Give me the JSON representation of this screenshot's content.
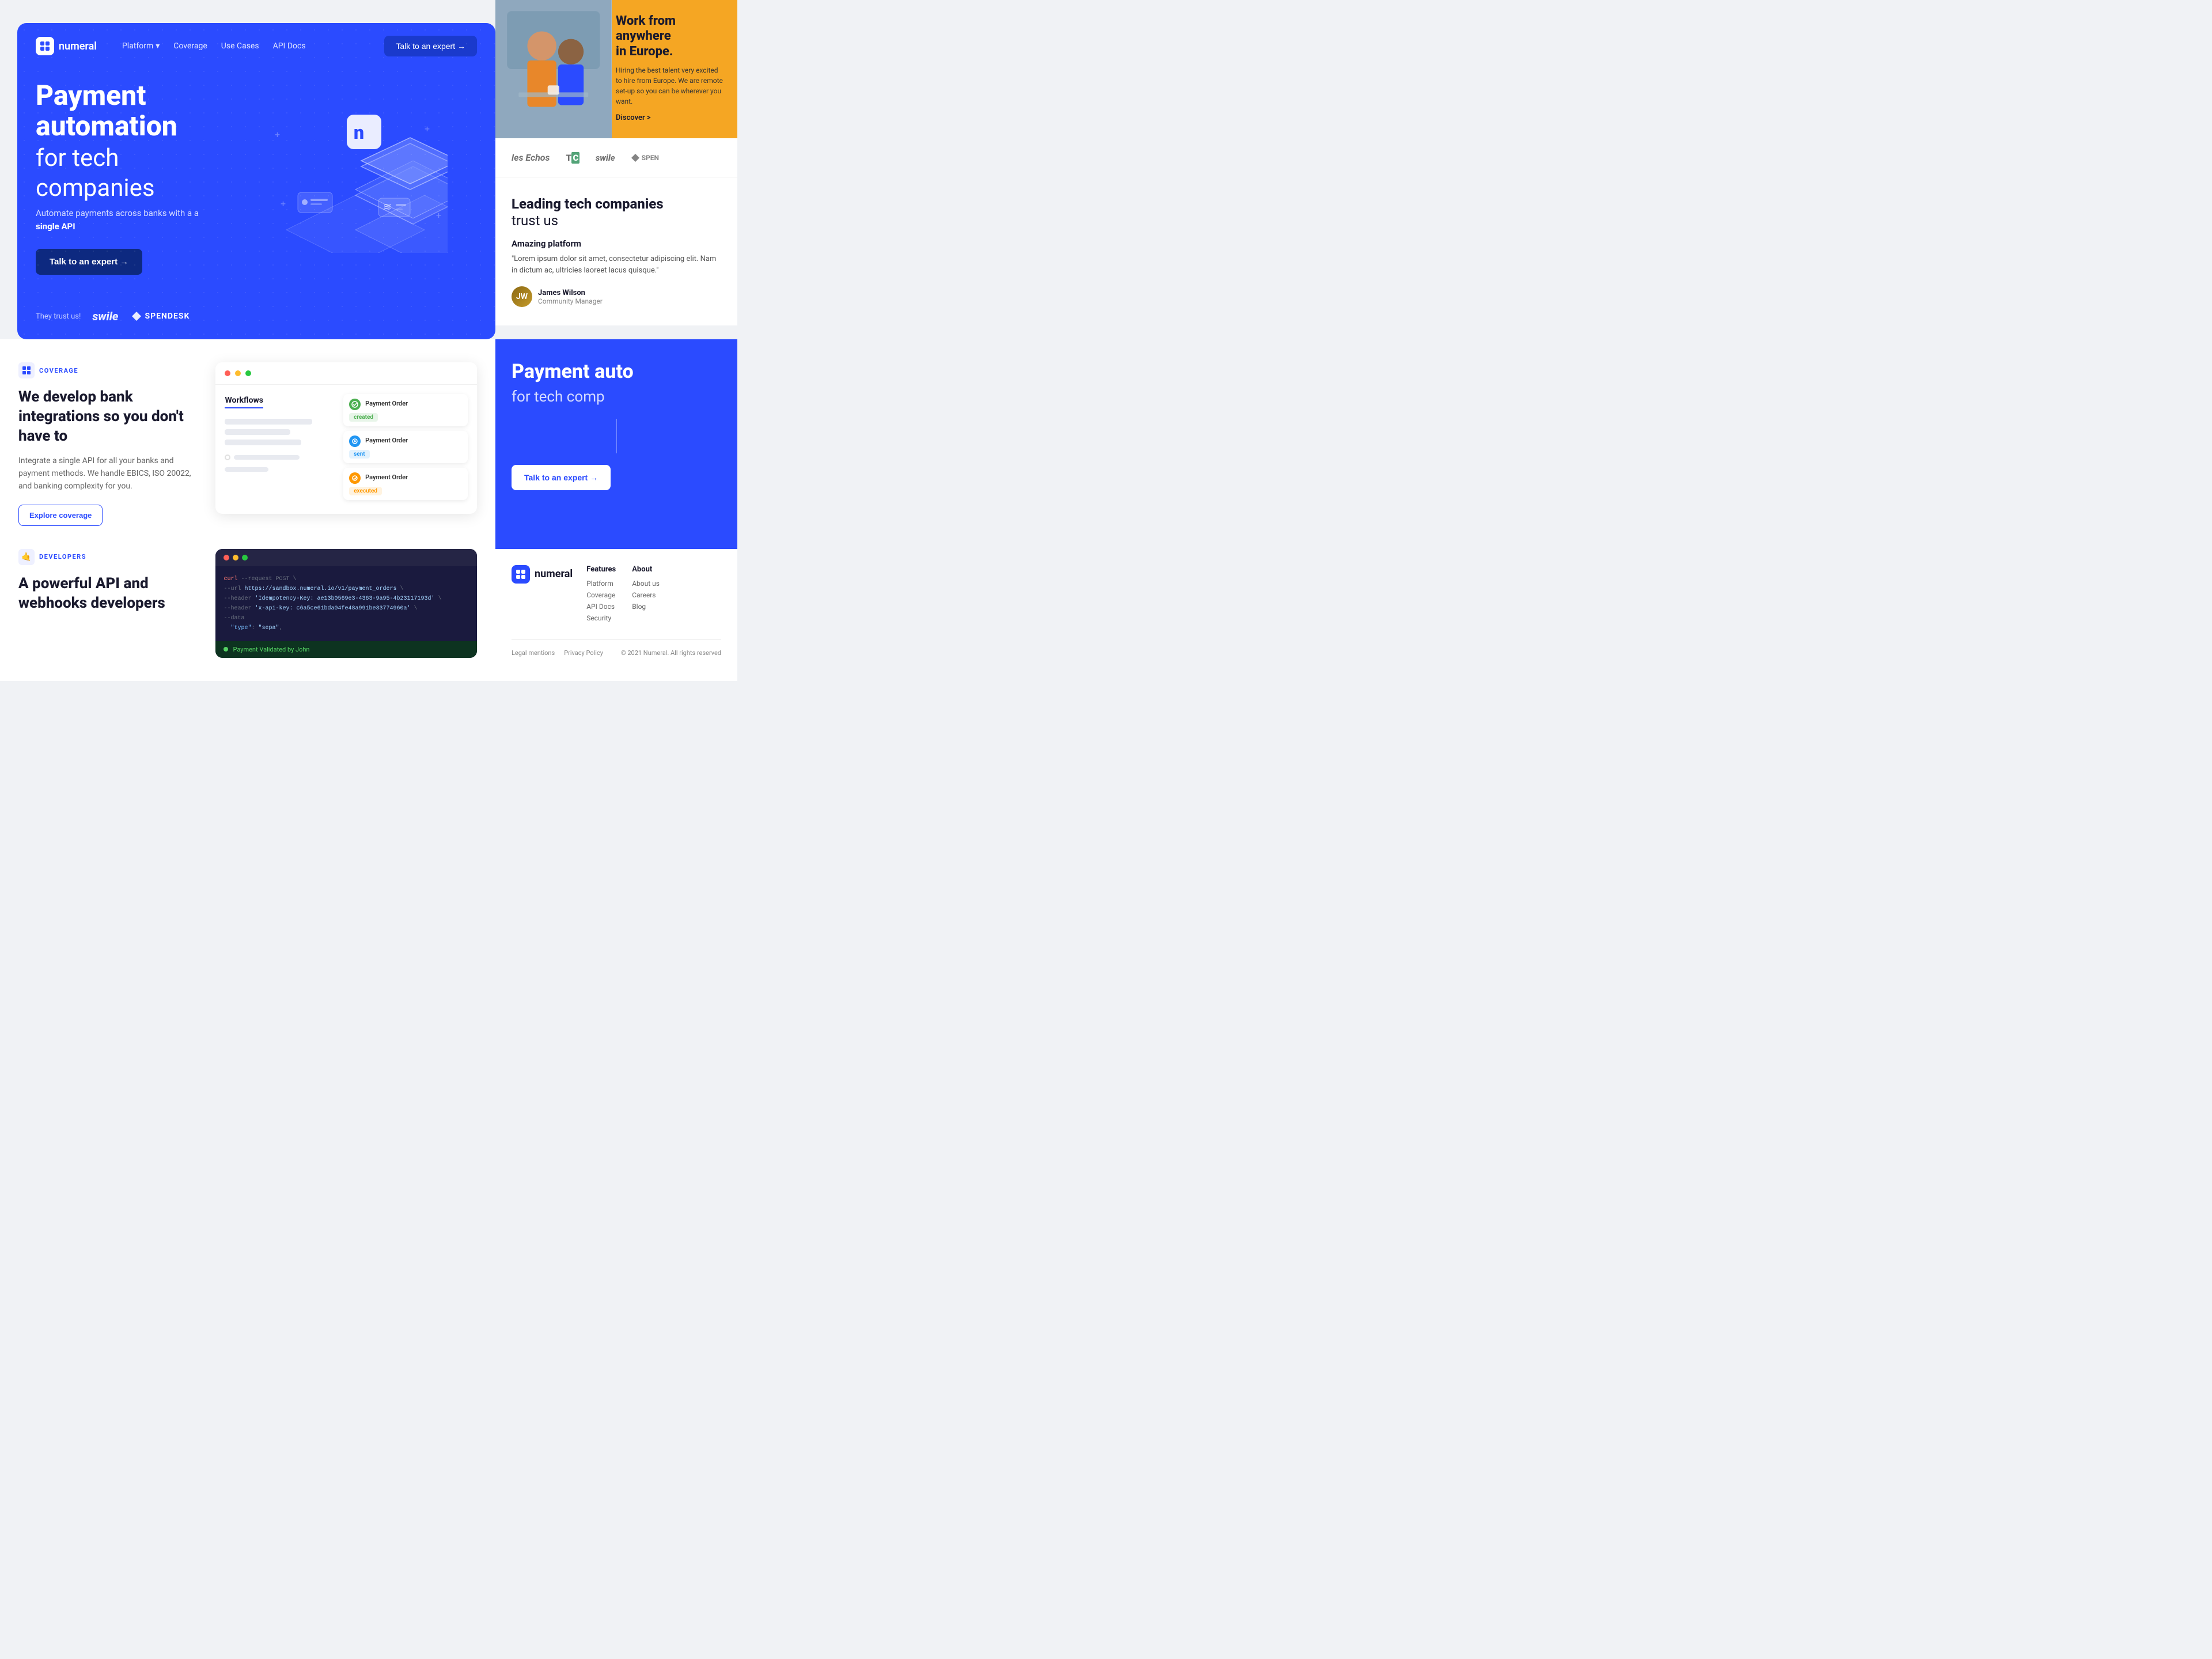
{
  "nav": {
    "logo": "numeral",
    "links": [
      {
        "label": "Platform",
        "has_dropdown": true
      },
      {
        "label": "Coverage"
      },
      {
        "label": "Use Cases"
      },
      {
        "label": "API Docs"
      }
    ],
    "cta_label": "Talk to an expert →"
  },
  "hero": {
    "title_bold": "Payment automation",
    "title_light": "for tech companies",
    "subtitle": "Automate payments across banks with a",
    "subtitle_bold": "single API",
    "cta_label": "Talk to an expert →"
  },
  "trust": {
    "label": "They trust us!",
    "logos": [
      "swile",
      "SPENDESK"
    ]
  },
  "work_card": {
    "title": "Work from anywhere in Europe.",
    "description": "Hiring the best talent very excited to hire from Europe. We are remote set-up so you can be wherever you want.",
    "discover_label": "Discover >"
  },
  "press": {
    "logos": [
      "les Echos",
      "TechCrunch",
      "swile",
      "SPEN"
    ]
  },
  "testimonial": {
    "heading_bold": "Leading tech companies",
    "heading_light": "trust us",
    "card_title": "Amazing platform",
    "card_text": "\"Lorem ipsum dolor sit amet, consectetur adipiscing elit. Nam in dictum ac, ultricies laoreet lacus quisque.\"",
    "author_name": "James Wilson",
    "author_role": "Community Manager"
  },
  "coverage": {
    "tag": "COVERAGE",
    "heading": "We develop bank integrations so you don't have to",
    "description": "Integrate a single API for all your banks and payment methods. We handle EBICS, ISO 20022, and banking complexity for you.",
    "cta_label": "Explore coverage"
  },
  "workflow": {
    "title": "Workflows",
    "orders": [
      {
        "title": "Payment Order",
        "badge": "created",
        "badge_type": "created"
      },
      {
        "title": "Payment Order",
        "badge": "sent",
        "badge_type": "sent"
      },
      {
        "title": "Payment Order",
        "badge": "executed",
        "badge_type": "executed"
      }
    ]
  },
  "developers": {
    "tag": "DEVELOPERS",
    "heading": "A powerful API and webhooks developers",
    "code": {
      "method": "curl --request POST \\",
      "url": "--url https://sandbox.numeral.io/v1/payment_orders \\",
      "header1": "--header 'Idempotency-Key: ae13b0569e3-4363-9a95-4b23117193d \\",
      "header2": "--header 'x-api-key: c6a5ce61bda04fe48a991be33774960a' \\",
      "data": "--data",
      "type_line": "\"type\": \"sepa\",",
      "validated_by": "Payment Validated by John"
    }
  },
  "cta_section": {
    "title": "Payment auto",
    "subtitle": "for tech comp",
    "cta_label": "Talk to an expert →"
  },
  "footer": {
    "logo": "numeral",
    "features": {
      "title": "Features",
      "links": [
        "Platform",
        "Coverage",
        "API Docs",
        "Security"
      ]
    },
    "about": {
      "title": "About",
      "links": [
        "About us",
        "Careers",
        "Blog"
      ]
    },
    "legal": [
      "Legal mentions",
      "Privacy Policy"
    ],
    "copyright": "© 2021 Numeral. All rights reserved"
  }
}
